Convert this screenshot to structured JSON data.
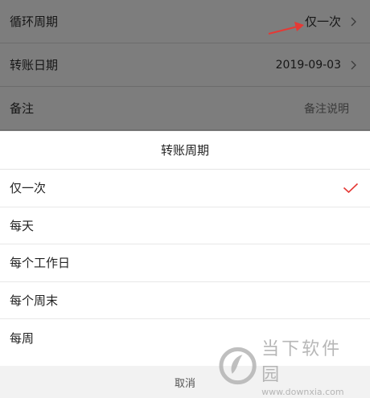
{
  "form": {
    "rows": [
      {
        "label": "循环周期",
        "value": "仅一次"
      },
      {
        "label": "转账日期",
        "value": "2019-09-03"
      },
      {
        "label": "备注",
        "placeholder": "备注说明"
      }
    ]
  },
  "sheet": {
    "title": "转账周期",
    "options": [
      {
        "label": "仅一次",
        "selected": true
      },
      {
        "label": "每天",
        "selected": false
      },
      {
        "label": "每个工作日",
        "selected": false
      },
      {
        "label": "每个周末",
        "selected": false
      },
      {
        "label": "每周",
        "selected": false
      }
    ],
    "cancel_label": "取消"
  },
  "watermark": {
    "name": "当下软件园",
    "url": "www.downxia.com"
  },
  "colors": {
    "check": "#e53935",
    "annotation_arrow": "#e53935",
    "overlay": "#7d7d7d"
  }
}
